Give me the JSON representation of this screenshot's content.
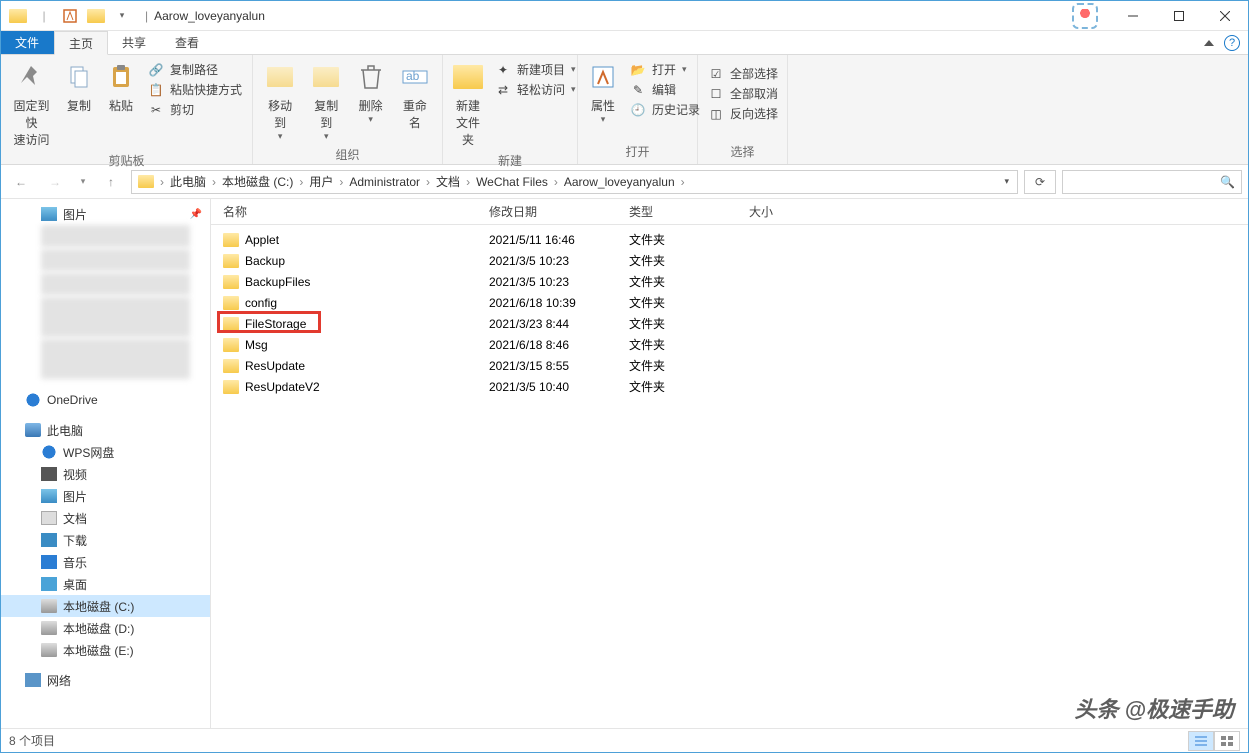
{
  "title": "Aarow_loveyanyalun",
  "tabs": {
    "file": "文件",
    "home": "主页",
    "share": "共享",
    "view": "查看"
  },
  "ribbon": {
    "clipboard": {
      "label": "剪贴板",
      "pin": "固定到快\n速访问",
      "copy": "复制",
      "paste": "粘贴",
      "copypath": "复制路径",
      "pasteshortcut": "粘贴快捷方式",
      "cut": "剪切"
    },
    "organize": {
      "label": "组织",
      "moveto": "移动到",
      "copyto": "复制到",
      "delete": "删除",
      "rename": "重命名"
    },
    "new": {
      "label": "新建",
      "newfolder": "新建\n文件夹",
      "newitem": "新建项目",
      "easyaccess": "轻松访问"
    },
    "open": {
      "label": "打开",
      "properties": "属性",
      "open": "打开",
      "edit": "编辑",
      "history": "历史记录"
    },
    "select": {
      "label": "选择",
      "selectall": "全部选择",
      "selectnone": "全部取消",
      "invert": "反向选择"
    }
  },
  "breadcrumb": [
    "此电脑",
    "本地磁盘 (C:)",
    "用户",
    "Administrator",
    "文档",
    "WeChat Files",
    "Aarow_loveyanyalun"
  ],
  "columns": {
    "name": "名称",
    "date": "修改日期",
    "type": "类型",
    "size": "大小"
  },
  "rows": [
    {
      "name": "Applet",
      "date": "2021/5/11 16:46",
      "type": "文件夹"
    },
    {
      "name": "Backup",
      "date": "2021/3/5 10:23",
      "type": "文件夹"
    },
    {
      "name": "BackupFiles",
      "date": "2021/3/5 10:23",
      "type": "文件夹"
    },
    {
      "name": "config",
      "date": "2021/6/18 10:39",
      "type": "文件夹"
    },
    {
      "name": "FileStorage",
      "date": "2021/3/23 8:44",
      "type": "文件夹",
      "highlight": true
    },
    {
      "name": "Msg",
      "date": "2021/6/18 8:46",
      "type": "文件夹"
    },
    {
      "name": "ResUpdate",
      "date": "2021/3/15 8:55",
      "type": "文件夹"
    },
    {
      "name": "ResUpdateV2",
      "date": "2021/3/5 10:40",
      "type": "文件夹"
    }
  ],
  "nav": {
    "pictures": "图片",
    "onedrive": "OneDrive",
    "thispc": "此电脑",
    "wps": "WPS网盘",
    "videos": "视频",
    "pics2": "图片",
    "docs": "文档",
    "downloads": "下载",
    "music": "音乐",
    "desktop": "桌面",
    "drivec": "本地磁盘 (C:)",
    "drived": "本地磁盘 (D:)",
    "drivee": "本地磁盘 (E:)",
    "network": "网络"
  },
  "status": "8 个项目",
  "watermark": "头条 @极速手助"
}
